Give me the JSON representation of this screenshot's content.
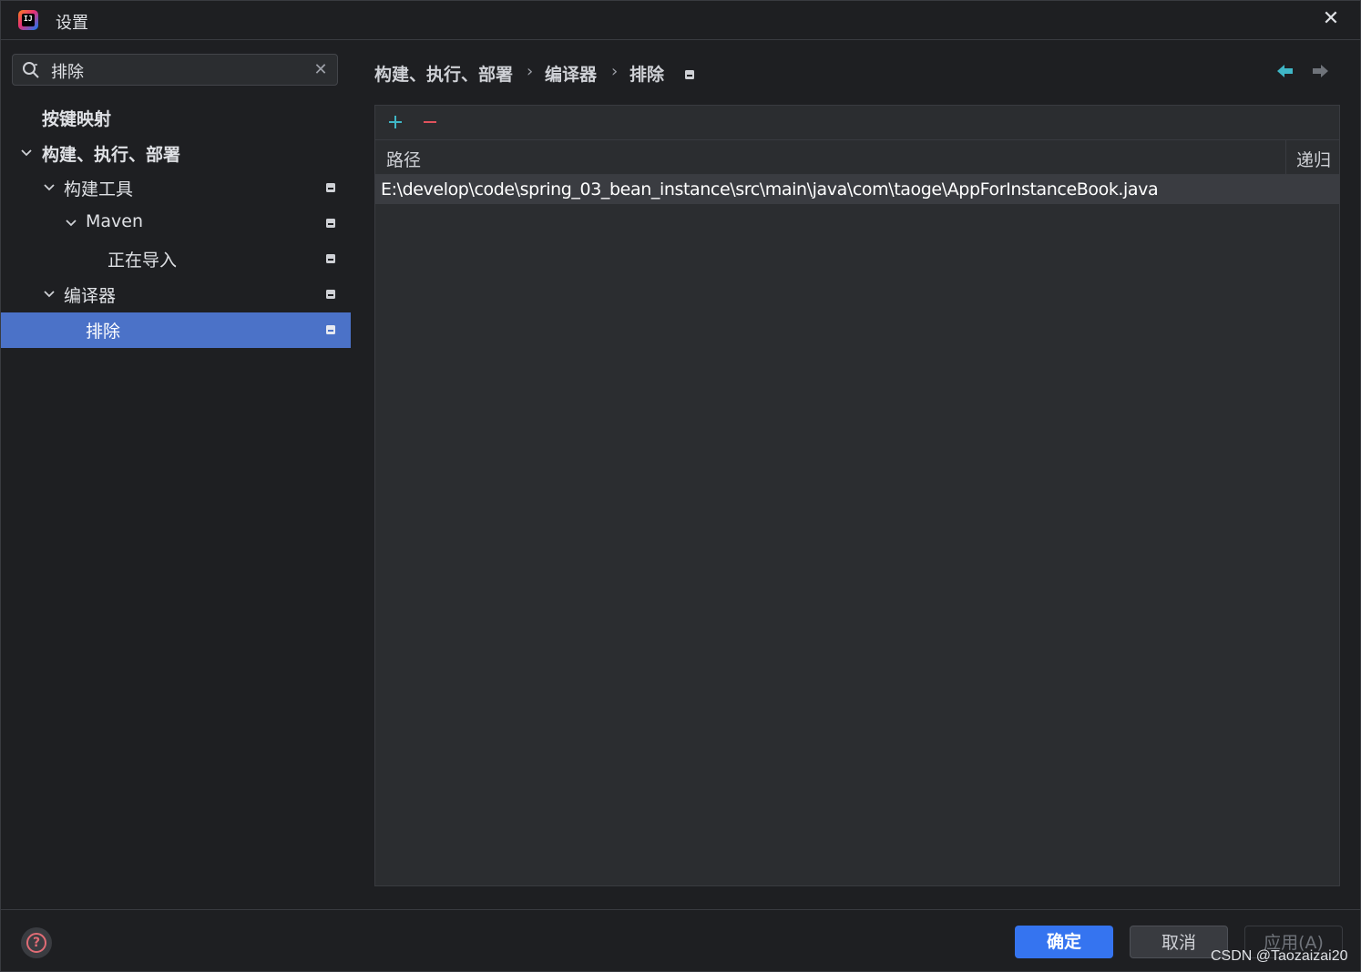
{
  "window": {
    "title": "设置",
    "app_icon_text": "IJ"
  },
  "search": {
    "value": "排除"
  },
  "tree": [
    {
      "label": "按键映射",
      "bold": true
    },
    {
      "label": "构建、执行、部署",
      "bold": true
    },
    {
      "label": "构建工具"
    },
    {
      "label": "Maven"
    },
    {
      "label": "正在导入"
    },
    {
      "label": "编译器"
    },
    {
      "label": "排除",
      "selected": true
    }
  ],
  "breadcrumb": {
    "item1": "构建、执行、部署",
    "item2": "编译器",
    "item3": "排除",
    "separator": "›"
  },
  "table": {
    "columns": {
      "path": "路径",
      "recursive": "递归"
    },
    "rows": [
      {
        "path": "E:\\develop\\code\\spring_03_bean_instance\\src\\main\\java\\com\\taoge\\AppForInstanceBook.java"
      }
    ]
  },
  "footer": {
    "ok_label": "确定",
    "cancel_label": "取消",
    "apply_label": "应用(A)"
  },
  "watermark": "CSDN @Taozaizai20",
  "colors": {
    "accent": "#3574f0",
    "selection": "#4b72c8",
    "add": "#3fb6c6",
    "remove": "#e0525c",
    "background": "#1e1f22",
    "panel": "#2b2d30"
  },
  "icons": {
    "app": "intellij-idea-icon",
    "close": "close-icon",
    "search": "search-icon",
    "clear": "clear-icon",
    "chevron": "chevron-down-icon",
    "project_scope": "project-scope-icon",
    "back": "back-arrow-icon",
    "forward": "forward-arrow-icon",
    "add": "plus-icon",
    "remove": "minus-icon",
    "help": "help-icon"
  }
}
